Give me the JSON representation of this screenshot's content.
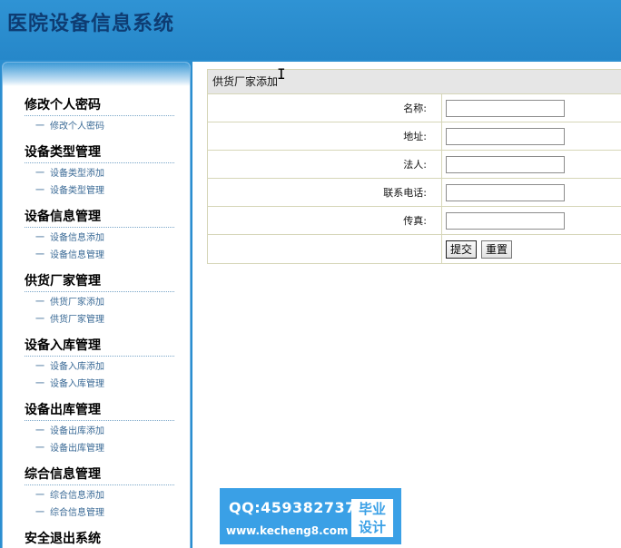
{
  "app": {
    "title": "医院设备信息系统"
  },
  "sidebar": {
    "groups": [
      {
        "title": "修改个人密码",
        "items": [
          "修改个人密码"
        ]
      },
      {
        "title": "设备类型管理",
        "items": [
          "设备类型添加",
          "设备类型管理"
        ]
      },
      {
        "title": "设备信息管理",
        "items": [
          "设备信息添加",
          "设备信息管理"
        ]
      },
      {
        "title": "供货厂家管理",
        "items": [
          "供货厂家添加",
          "供货厂家管理"
        ]
      },
      {
        "title": "设备入库管理",
        "items": [
          "设备入库添加",
          "设备入库管理"
        ]
      },
      {
        "title": "设备出库管理",
        "items": [
          "设备出库添加",
          "设备出库管理"
        ]
      },
      {
        "title": "综合信息管理",
        "items": [
          "综合信息添加",
          "综合信息管理"
        ]
      },
      {
        "title": "安全退出系统",
        "items": [
          "安全退出系统"
        ]
      }
    ],
    "bullet": "一"
  },
  "form": {
    "title": "供货厂家添加",
    "fields": [
      {
        "label": "名称:",
        "value": ""
      },
      {
        "label": "地址:",
        "value": ""
      },
      {
        "label": "法人:",
        "value": ""
      },
      {
        "label": "联系电话:",
        "value": ""
      },
      {
        "label": "传真:",
        "value": ""
      }
    ],
    "submit_label": "提交",
    "reset_label": "重置"
  },
  "watermark": {
    "qq": "QQ:459382737",
    "url": "www.kecheng8.com",
    "badge_line1": "毕业",
    "badge_line2": "设计"
  },
  "colors": {
    "header_bg": "#2b8ed0",
    "title_color": "#0e3c72",
    "link_color": "#3a6a96",
    "watermark_bg": "#3aa0e6"
  }
}
